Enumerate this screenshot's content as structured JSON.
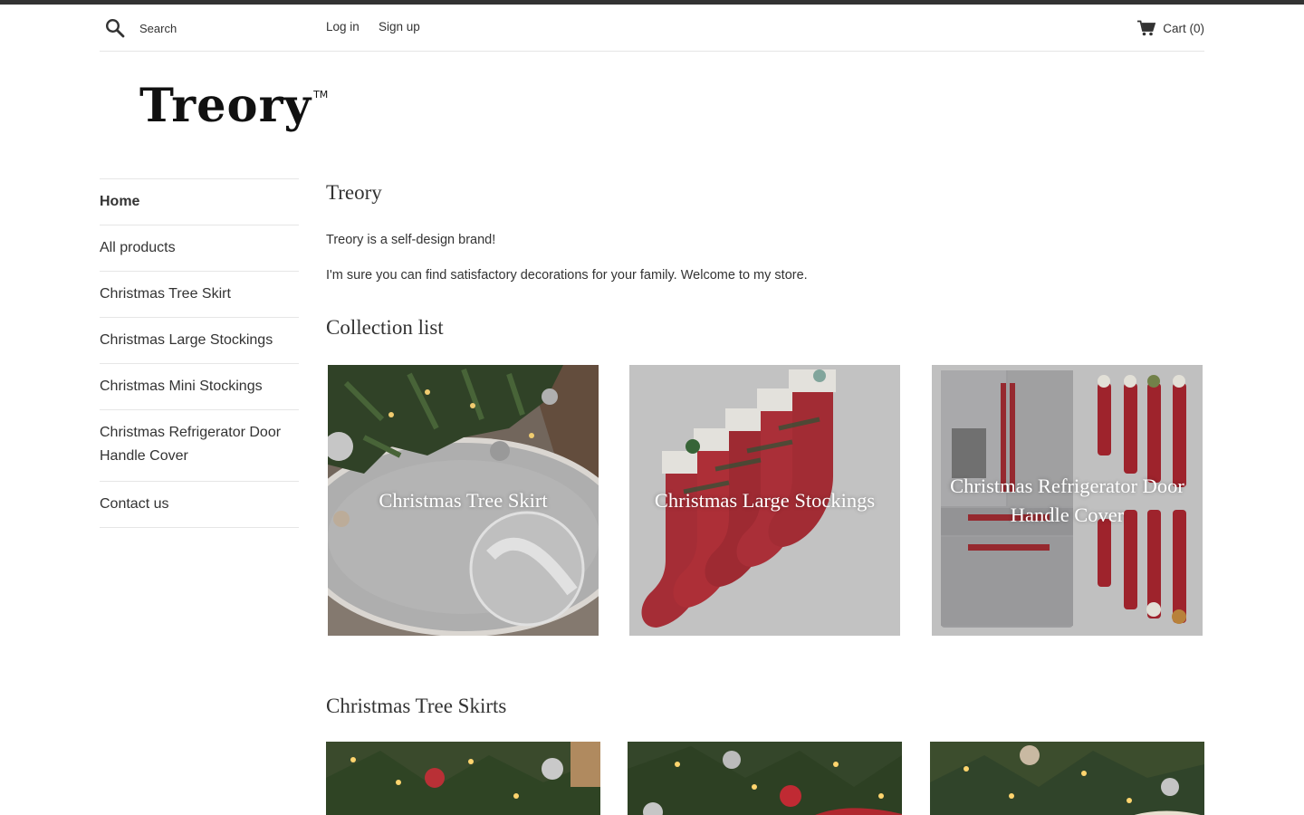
{
  "header": {
    "search_placeholder": "Search",
    "login_label": "Log in",
    "signup_label": "Sign up",
    "cart_label": "Cart (0)"
  },
  "logo": {
    "text": "Treory",
    "mark": "TM"
  },
  "sidebar": {
    "items": [
      {
        "label": "Home",
        "active": true
      },
      {
        "label": "All products"
      },
      {
        "label": "Christmas Tree Skirt"
      },
      {
        "label": "Christmas Large Stockings"
      },
      {
        "label": "Christmas Mini Stockings"
      },
      {
        "label": "Christmas Refrigerator Door Handle Cover"
      },
      {
        "label": "Contact us"
      }
    ]
  },
  "main": {
    "title": "Treory",
    "intro_lines": [
      "Treory is a self-design brand!",
      "I'm sure you can find satisfactory decorations for your family. Welcome to my store."
    ],
    "collection_heading": "Collection list",
    "collections": [
      {
        "label": "Christmas Tree Skirt"
      },
      {
        "label": "Christmas Large Stockings"
      },
      {
        "label": "Christmas Refrigerator Door Handle Cover"
      }
    ],
    "skirts_heading": "Christmas Tree Skirts"
  },
  "colors": {
    "top_strip": "#333333",
    "text": "#333333",
    "divider": "#e6e6e6"
  }
}
